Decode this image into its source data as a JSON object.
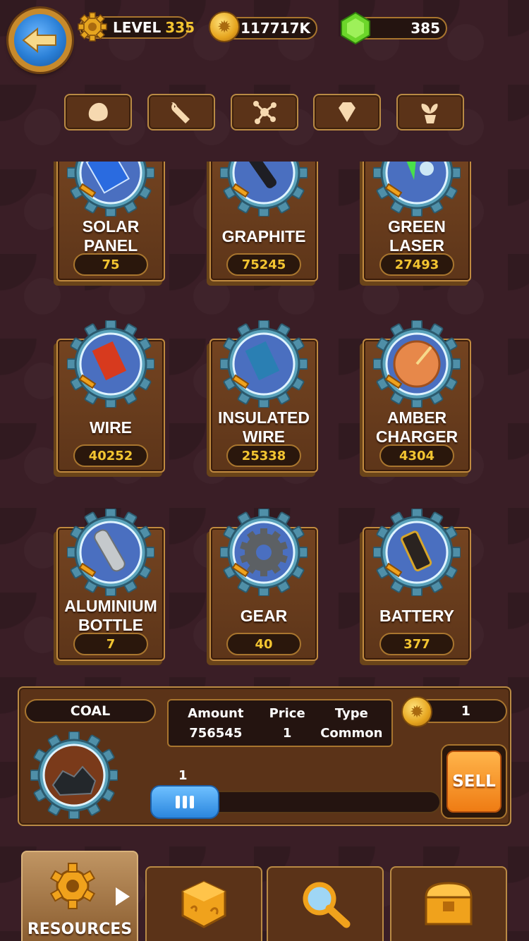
{
  "header": {
    "level_label": "LEVEL",
    "level_value": "335",
    "coins": "117717K",
    "gems": "385"
  },
  "category_tabs": [
    {
      "icon": "rock-icon"
    },
    {
      "icon": "wrench-icon"
    },
    {
      "icon": "molecule-icon"
    },
    {
      "icon": "diamond-icon"
    },
    {
      "icon": "plant-icon"
    }
  ],
  "items": [
    {
      "name": "SOLAR\nPANEL",
      "value": "75",
      "icon": "solar-panel-icon"
    },
    {
      "name": "GRAPHITE",
      "value": "75245",
      "icon": "graphite-icon"
    },
    {
      "name": "GREEN\nLASER",
      "value": "27493",
      "icon": "green-laser-icon"
    },
    {
      "name": "WIRE",
      "value": "40252",
      "icon": "wire-spool-icon"
    },
    {
      "name": "INSULATED\nWIRE",
      "value": "25338",
      "icon": "insulated-wire-icon"
    },
    {
      "name": "AMBER\nCHARGER",
      "value": "4304",
      "icon": "amber-charger-icon"
    },
    {
      "name": "ALUMINIUM\nBOTTLE",
      "value": "7",
      "icon": "bottle-icon"
    },
    {
      "name": "GEAR",
      "value": "40",
      "icon": "gear-icon"
    },
    {
      "name": "BATTERY",
      "value": "377",
      "icon": "battery-icon"
    }
  ],
  "detail": {
    "name": "COAL",
    "amount_label": "Amount",
    "amount_value": "756545",
    "price_label": "Price",
    "price_value": "1",
    "type_label": "Type",
    "type_value": "Common",
    "total": "1",
    "slider_value": "1",
    "slider_fraction": 0,
    "sell_label": "SELL"
  },
  "bottom_tabs": [
    {
      "label": "RESOURCES",
      "icon": "gear-icon",
      "active": true
    },
    {
      "label": "",
      "icon": "dice-icon"
    },
    {
      "label": "",
      "icon": "magnifier-icon"
    },
    {
      "label": "",
      "icon": "chest-icon"
    }
  ],
  "colors": {
    "background": "#3a1e26",
    "gold_text": "#f3c531",
    "panel": "#5b3318",
    "border": "#b98a44"
  }
}
